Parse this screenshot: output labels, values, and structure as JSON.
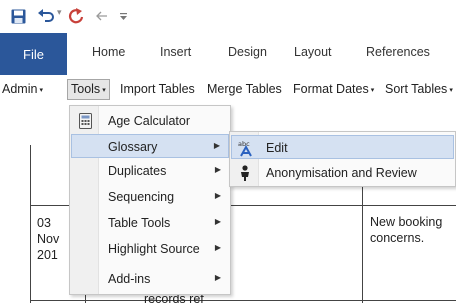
{
  "quick_access": {
    "save_icon": "save-icon",
    "undo_icon": "undo-icon",
    "redo_icon": "redo-icon",
    "back_icon": "back-arrow-icon",
    "customize_icon": "customize-toolbar-icon"
  },
  "ribbon": {
    "tabs": [
      "File",
      "Home",
      "Insert",
      "Design",
      "Layout",
      "References"
    ]
  },
  "toolbar": {
    "items": [
      {
        "label": "Admin",
        "caret": "▾"
      },
      {
        "label": "Tools",
        "caret": "▾"
      },
      {
        "label": "Import Tables",
        "caret": ""
      },
      {
        "label": "Merge Tables",
        "caret": ""
      },
      {
        "label": "Format Dates",
        "caret": "▾"
      },
      {
        "label": "Sort Tables",
        "caret": "▾"
      }
    ]
  },
  "document": {
    "date_lines": [
      "03",
      "Nov",
      "201"
    ],
    "booking_text": [
      "New booking",
      "concerns."
    ],
    "partial_text": "records ref"
  },
  "tools_menu": {
    "items": [
      {
        "label": "Age Calculator",
        "icon": "calculator-icon",
        "submenu": false
      },
      {
        "label": "Glossary",
        "icon": "",
        "submenu": true
      },
      {
        "label": "Duplicates",
        "icon": "",
        "submenu": true
      },
      {
        "label": "Sequencing",
        "icon": "",
        "submenu": true
      },
      {
        "label": "Table Tools",
        "icon": "",
        "submenu": true
      },
      {
        "label": "Highlight Source",
        "icon": "",
        "submenu": true
      },
      {
        "label": "Add-ins",
        "icon": "",
        "submenu": true
      }
    ],
    "highlighted": "Glossary"
  },
  "glossary_submenu": {
    "items": [
      {
        "label": "Edit",
        "icon": "abc-edit-icon"
      },
      {
        "label": "Anonymisation and Review",
        "icon": "anonymisation-icon"
      }
    ],
    "highlighted": "Edit"
  },
  "colors": {
    "file_tab": "#2b579a",
    "accent_red": "#c8413a",
    "highlight": "#d5e1f2"
  }
}
